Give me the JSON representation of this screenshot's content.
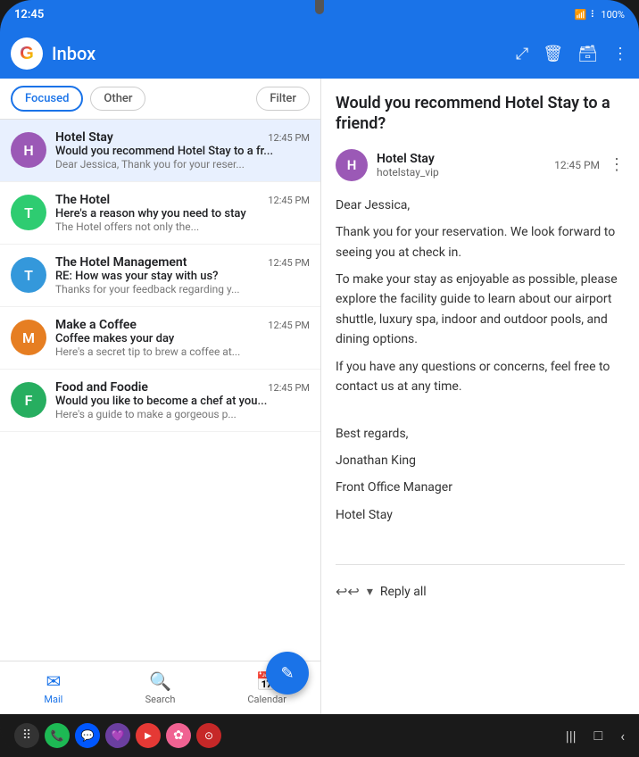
{
  "status_bar": {
    "time": "12:45",
    "battery": "100%",
    "signal": "●●●",
    "wifi": "wifi"
  },
  "app_bar": {
    "title": "Inbox",
    "actions": {
      "expand": "⤢",
      "delete": "🗑",
      "archive": "🗃",
      "more": "⋮"
    }
  },
  "tabs": {
    "focused": "Focused",
    "other": "Other",
    "filter": "Filter"
  },
  "emails": [
    {
      "id": "hotel-stay",
      "initial": "H",
      "avatar_color": "#9b59b6",
      "sender": "Hotel Stay",
      "subject": "Would you recommend Hotel Stay to a fr...",
      "preview": "Dear Jessica, Thank you for your reser...",
      "time": "12:45 PM",
      "selected": true
    },
    {
      "id": "the-hotel",
      "initial": "T",
      "avatar_color": "#2ecc71",
      "sender": "The Hotel",
      "subject": "Here's a reason why you need to stay",
      "preview": "The Hotel offers not only the...",
      "time": "12:45 PM",
      "selected": false
    },
    {
      "id": "hotel-management",
      "initial": "T",
      "avatar_color": "#3498db",
      "sender": "The Hotel Management",
      "subject": "RE: How was your stay with us?",
      "preview": "Thanks for your feedback regarding y...",
      "time": "12:45 PM",
      "selected": false
    },
    {
      "id": "make-coffee",
      "initial": "M",
      "avatar_color": "#e67e22",
      "sender": "Make a Coffee",
      "subject": "Coffee makes your day",
      "preview": "Here's a secret tip to brew a coffee at...",
      "time": "12:45 PM",
      "selected": false
    },
    {
      "id": "food-foodie",
      "initial": "F",
      "avatar_color": "#27ae60",
      "sender": "Food and Foodie",
      "subject": "Would you like to become a chef at you...",
      "preview": "Here's a guide to make a gorgeous p...",
      "time": "12:45 PM",
      "selected": false
    }
  ],
  "email_detail": {
    "subject": "Would you recommend Hotel Stay to a friend?",
    "sender_name": "Hotel Stay",
    "sender_email": "hotelstay_vip",
    "sender_initial": "H",
    "sender_color": "#9b59b6",
    "time": "12:45 PM",
    "more_icon": "⋮",
    "greeting": "Dear Jessica,",
    "body_paragraphs": [
      "Thank you for your reservation. We look forward to seeing you at check in.",
      "To make your stay as enjoyable as possible, please explore the facility guide to learn about our airport shuttle, luxury spa, indoor and outdoor pools, and dining options.",
      "If you have any questions or concerns, feel free to contact us at any time."
    ],
    "signature": [
      "Best regards,",
      "Jonathan King",
      "Front Office Manager",
      "Hotel Stay"
    ],
    "reply_label": "Reply all"
  },
  "bottom_nav": {
    "items": [
      {
        "id": "mail",
        "label": "Mail",
        "icon": "✉",
        "active": true
      },
      {
        "id": "search",
        "label": "Search",
        "icon": "🔍",
        "active": false
      },
      {
        "id": "calendar",
        "label": "Calendar",
        "icon": "📅",
        "active": false
      }
    ]
  },
  "fab": {
    "icon": "✎"
  },
  "android_nav": {
    "apps": [
      {
        "color": "#333",
        "icon": "⠿"
      },
      {
        "color": "#1DB954",
        "icon": "📞"
      },
      {
        "color": "#0057FF",
        "icon": "💬"
      },
      {
        "color": "#6B3FA0",
        "icon": "💜"
      },
      {
        "color": "#E53935",
        "icon": "▶"
      },
      {
        "color": "#F06292",
        "icon": "✿"
      },
      {
        "color": "#C62828",
        "icon": "⊙"
      }
    ],
    "controls": [
      "|||",
      "□",
      "‹"
    ]
  }
}
